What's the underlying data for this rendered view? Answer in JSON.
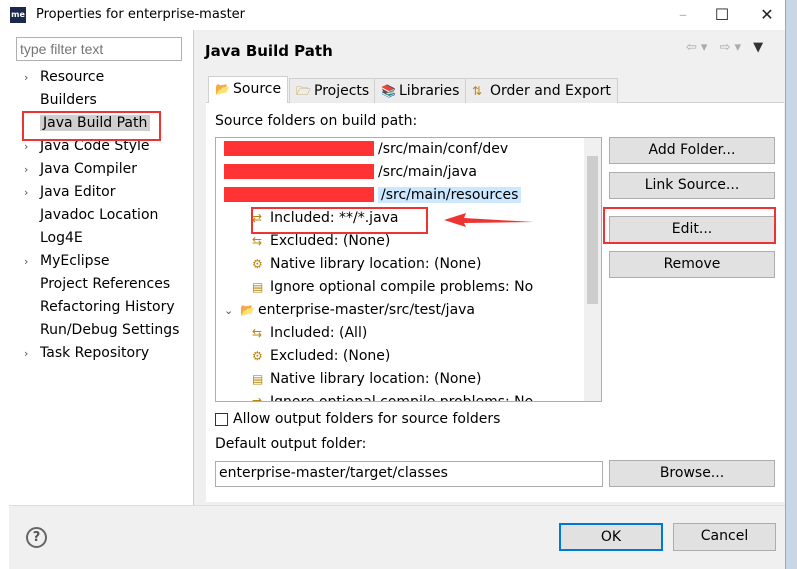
{
  "window": {
    "title": "Properties for enterprise-master",
    "app_icon": "me",
    "minimize": "–",
    "maximize": "☐",
    "close": "✕"
  },
  "sidebar": {
    "filter_placeholder": "type filter text",
    "items": [
      {
        "label": "Resource",
        "expandable": true
      },
      {
        "label": "Builders",
        "expandable": false
      },
      {
        "label": "Java Build Path",
        "expandable": false,
        "selected": true
      },
      {
        "label": "Java Code Style",
        "expandable": true
      },
      {
        "label": "Java Compiler",
        "expandable": true
      },
      {
        "label": "Java Editor",
        "expandable": true
      },
      {
        "label": "Javadoc Location",
        "expandable": false
      },
      {
        "label": "Log4E",
        "expandable": false
      },
      {
        "label": "MyEclipse",
        "expandable": true
      },
      {
        "label": "Project References",
        "expandable": false
      },
      {
        "label": "Refactoring History",
        "expandable": false
      },
      {
        "label": "Run/Debug Settings",
        "expandable": false
      },
      {
        "label": "Task Repository",
        "expandable": true
      }
    ]
  },
  "page": {
    "title": "Java Build Path",
    "tabs": [
      {
        "label": "Source",
        "active": true
      },
      {
        "label": "Projects"
      },
      {
        "label": "Libraries"
      },
      {
        "label": "Order and Export"
      }
    ],
    "source_label": "Source folders on build path:",
    "tree": [
      {
        "text": "/src/main/conf/dev",
        "level": 0,
        "redacted": true
      },
      {
        "text": "/src/main/java",
        "level": 0,
        "redacted": true
      },
      {
        "text": "/src/main/resources",
        "level": 0,
        "redacted": true,
        "selected": true,
        "expanded": true
      },
      {
        "text": "Included: **/*.java",
        "level": 1
      },
      {
        "text": "Excluded: (None)",
        "level": 1
      },
      {
        "text": "Native library location: (None)",
        "level": 1
      },
      {
        "text": "Ignore optional compile problems: No",
        "level": 1
      },
      {
        "text": "enterprise-master/src/test/java",
        "level": 0,
        "expanded": true
      },
      {
        "text": "Included: (All)",
        "level": 1
      },
      {
        "text": "Excluded: (None)",
        "level": 1
      },
      {
        "text": "Native library location: (None)",
        "level": 1
      },
      {
        "text": "Ignore optional compile problems: No",
        "level": 1
      }
    ],
    "buttons": {
      "add_folder": "Add Folder...",
      "link_source": "Link Source...",
      "edit": "Edit...",
      "remove": "Remove",
      "browse": "Browse..."
    },
    "allow_output_label": "Allow output folders for source folders",
    "allow_output_checked": false,
    "default_output_label": "Default output folder:",
    "default_output_value": "enterprise-master/target/classes"
  },
  "footer": {
    "ok": "OK",
    "cancel": "Cancel",
    "help": "?"
  },
  "annotation_color": "#e33333"
}
